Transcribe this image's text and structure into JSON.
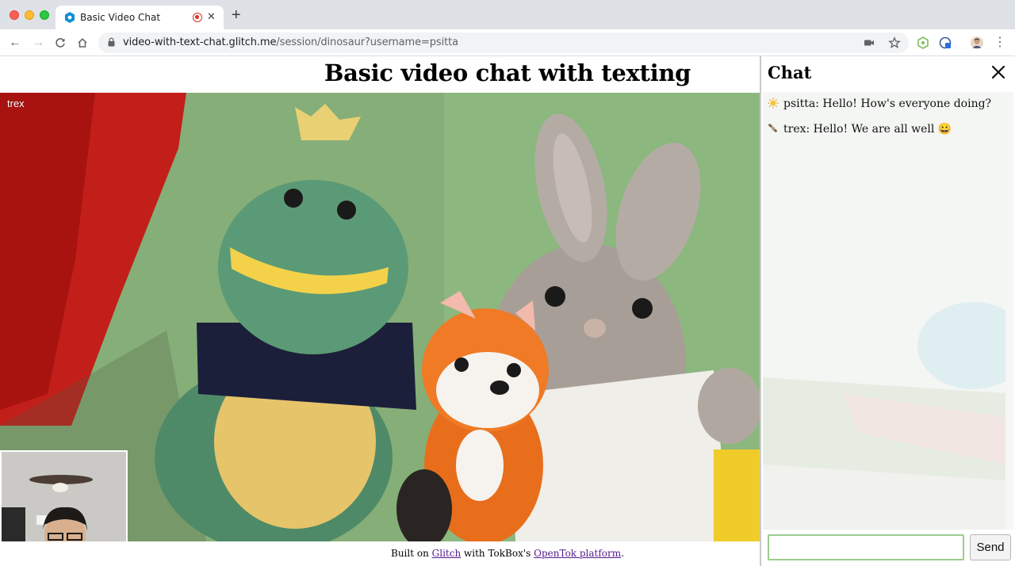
{
  "browser": {
    "tab_title": "Basic Video Chat",
    "url_host": "video-with-text-chat.glitch.me",
    "url_path": "/session/dinosaur?username=psitta"
  },
  "page": {
    "title": "Basic video chat with texting",
    "video_label": "trex",
    "footer": {
      "prefix": "Built on ",
      "glitch_link": "Glitch",
      "middle": " with TokBox's ",
      "opentok_link": "OpenTok platform",
      "suffix": "."
    }
  },
  "chat": {
    "title": "Chat",
    "messages": [
      {
        "icon": "sun-emoji-icon",
        "text": "psitta: Hello! How's everyone doing?"
      },
      {
        "icon": "satellite-emoji-icon",
        "text": "trex: Hello! We are all well 😀"
      }
    ],
    "input_value": "",
    "send_label": "Send"
  },
  "colors": {
    "chat_input_border": "#9dcc8e",
    "link": "#551a8b"
  }
}
